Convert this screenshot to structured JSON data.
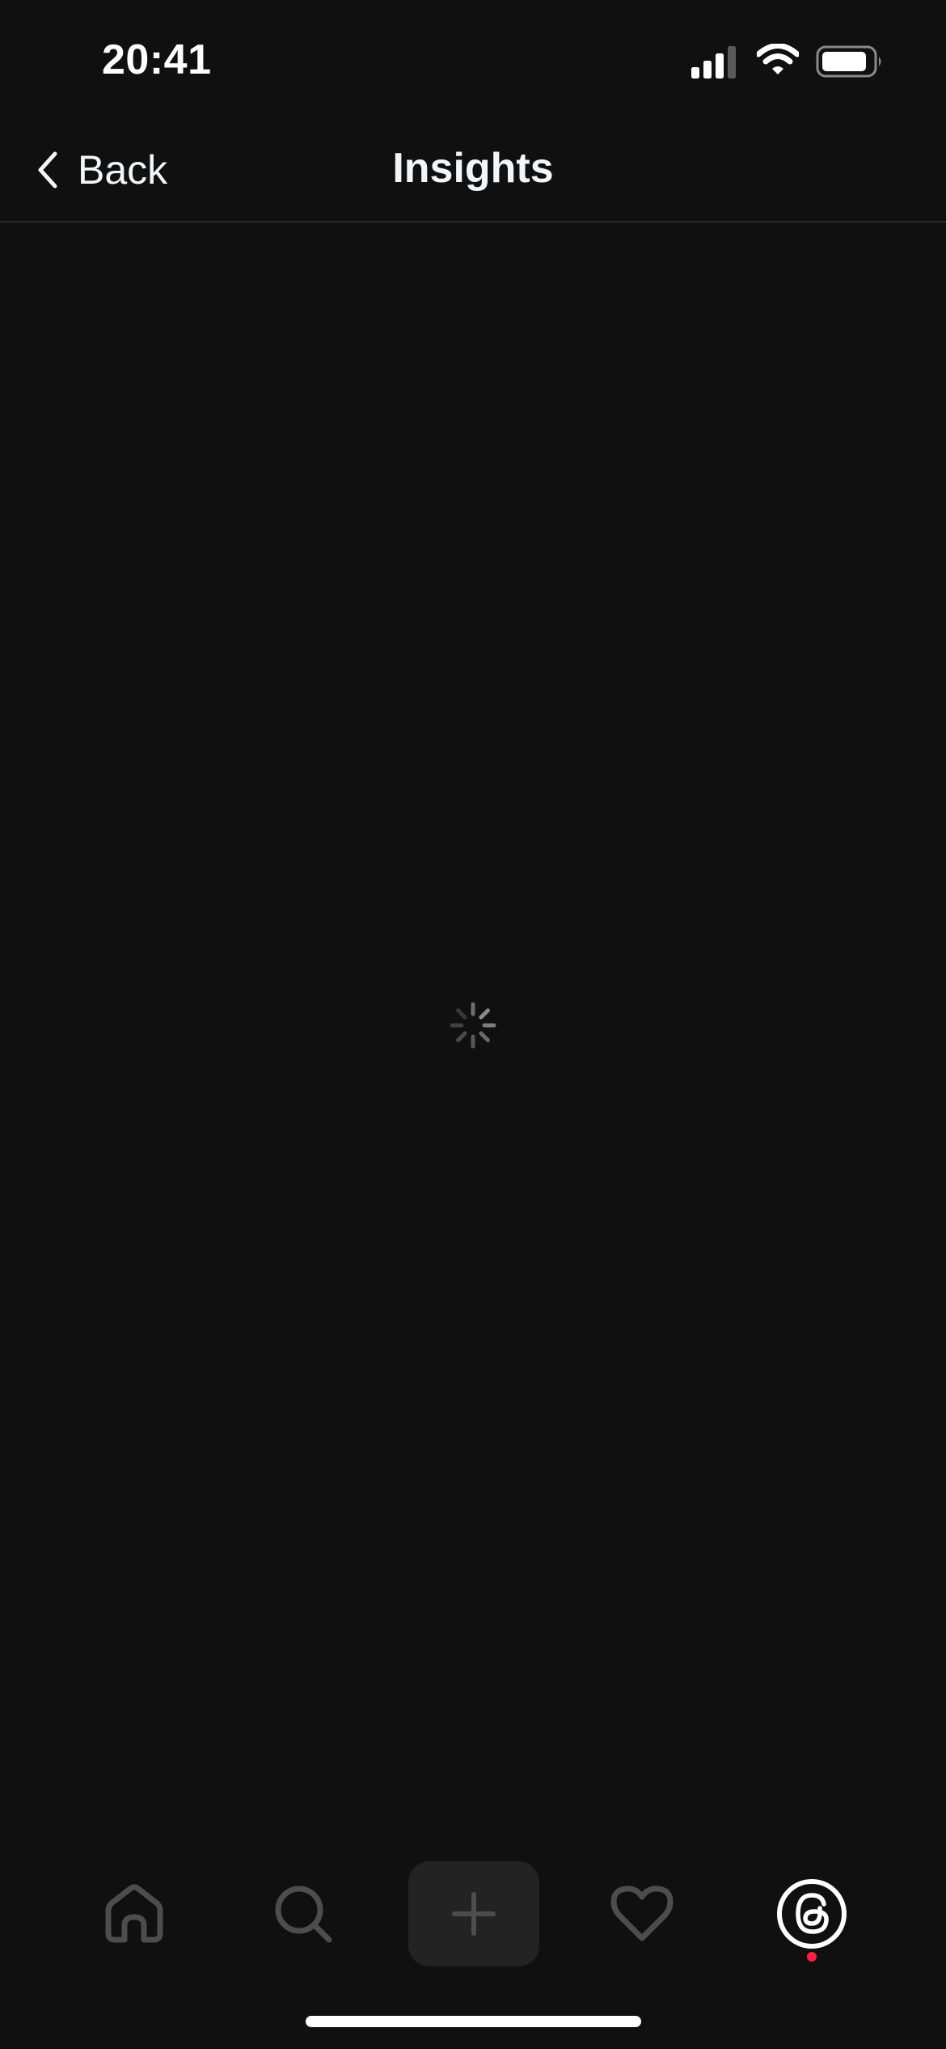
{
  "status_bar": {
    "time": "20:41",
    "icons": [
      "cellular-signal-icon",
      "wifi-icon",
      "battery-icon"
    ]
  },
  "nav": {
    "back_label": "Back",
    "title": "Insights"
  },
  "content": {
    "state": "loading",
    "icon": "loading-spinner-icon"
  },
  "tab_bar": {
    "tabs": [
      {
        "name": "home",
        "icon": "home-icon",
        "selected": false
      },
      {
        "name": "search",
        "icon": "search-icon",
        "selected": false
      },
      {
        "name": "create",
        "icon": "plus-icon",
        "selected": false
      },
      {
        "name": "activity",
        "icon": "heart-icon",
        "selected": false
      },
      {
        "name": "profile",
        "icon": "threads-logo-icon",
        "selected": true
      }
    ],
    "notification_dot_color": "#ff1f3d"
  },
  "colors": {
    "background": "#101010",
    "text": "#f3f5f7",
    "inactive_icon": "#4d4d4d",
    "create_button_bg": "#232323"
  }
}
